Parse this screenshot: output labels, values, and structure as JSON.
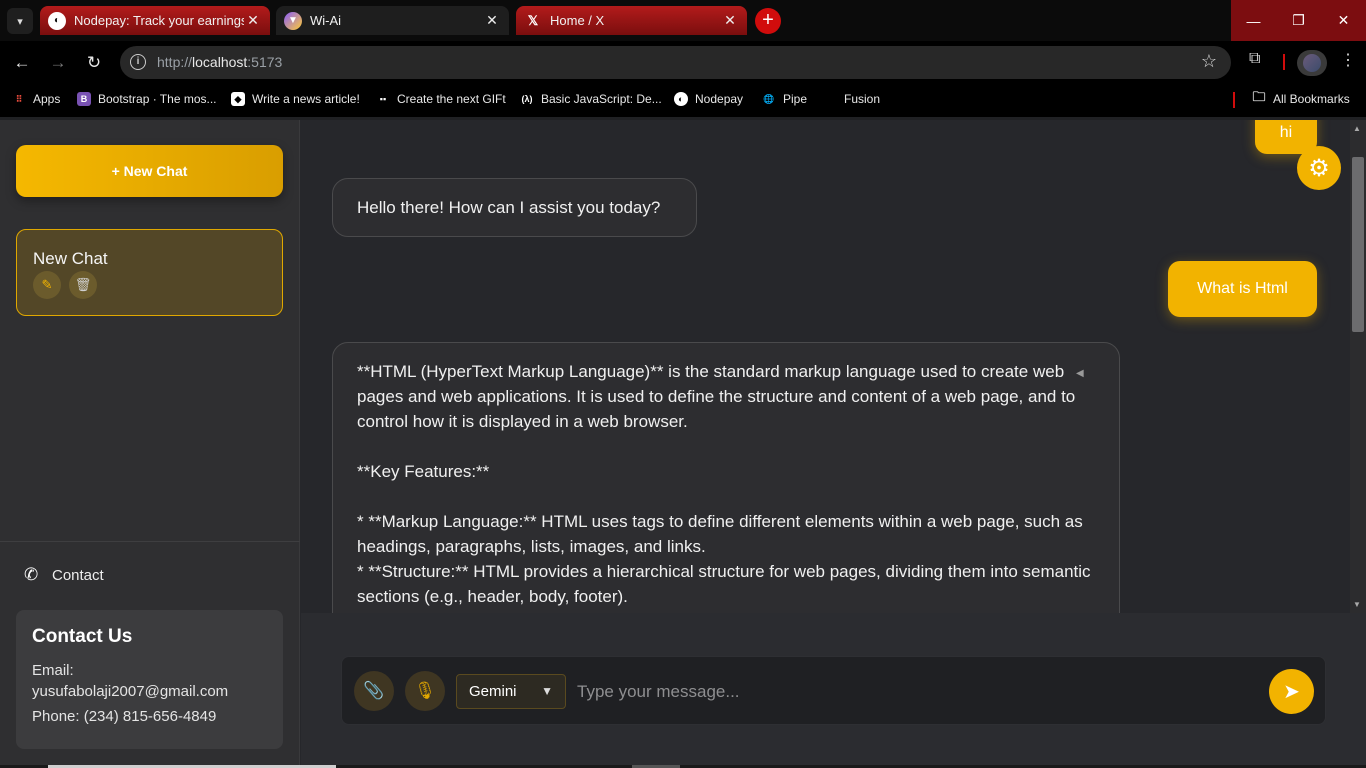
{
  "browser": {
    "tabs": [
      {
        "title": "Nodepay: Track your earnings",
        "close": "✕"
      },
      {
        "title": "Wi-Ai",
        "close": "✕"
      },
      {
        "title": "Home / X",
        "close": "✕"
      }
    ],
    "new_tab": "+",
    "url_host": "http://",
    "url_main": "localhost",
    "url_port": ":5173",
    "bookmarks": [
      {
        "label": "Apps",
        "icon": "apps-grid-icon"
      },
      {
        "label": "Bootstrap · The mos...",
        "icon": "bootstrap-icon"
      },
      {
        "label": "Write a news article!",
        "icon": "article-icon"
      },
      {
        "label": "Create the next GIFt",
        "icon": "gift-icon"
      },
      {
        "label": "Basic JavaScript: De...",
        "icon": "fcc-icon"
      },
      {
        "label": "Nodepay",
        "icon": "nodepay-icon"
      },
      {
        "label": "Pipe",
        "icon": "globe-icon"
      },
      {
        "label": "Fusion",
        "icon": "blank-icon"
      }
    ],
    "all_bookmarks": "All Bookmarks"
  },
  "sidebar": {
    "new_chat_label": "+ New Chat",
    "chats": [
      {
        "name": "New Chat"
      }
    ],
    "contact_link": "Contact",
    "contact_card": {
      "title": "Contact Us",
      "email_label": "Email:",
      "email": "yusufabolaji2007@gmail.com",
      "phone": "Phone: (234) 815-656-4849"
    }
  },
  "chat": {
    "messages": [
      {
        "role": "user",
        "text": "hi"
      },
      {
        "role": "bot",
        "text": "Hello there! How can I assist you today?"
      },
      {
        "role": "user",
        "text": "What is Html"
      },
      {
        "role": "bot",
        "text": "**HTML (HyperText Markup Language)** is the standard markup language used to create web pages and web applications. It is used to define the structure and content of a web page, and to control how it is displayed in a web browser.\n\n**Key Features:**\n\n* **Markup Language:** HTML uses tags to define different elements within a web page, such as headings, paragraphs, lists, images, and links.\n* **Structure:** HTML provides a hierarchical structure for web pages, dividing them into semantic sections (e.g., header, body, footer)."
      }
    ]
  },
  "composer": {
    "model": "Gemini",
    "placeholder": "Type your message..."
  },
  "colors": {
    "accent": "#f2b300",
    "background": "#26272b",
    "sidebar": "#2f2f31"
  }
}
